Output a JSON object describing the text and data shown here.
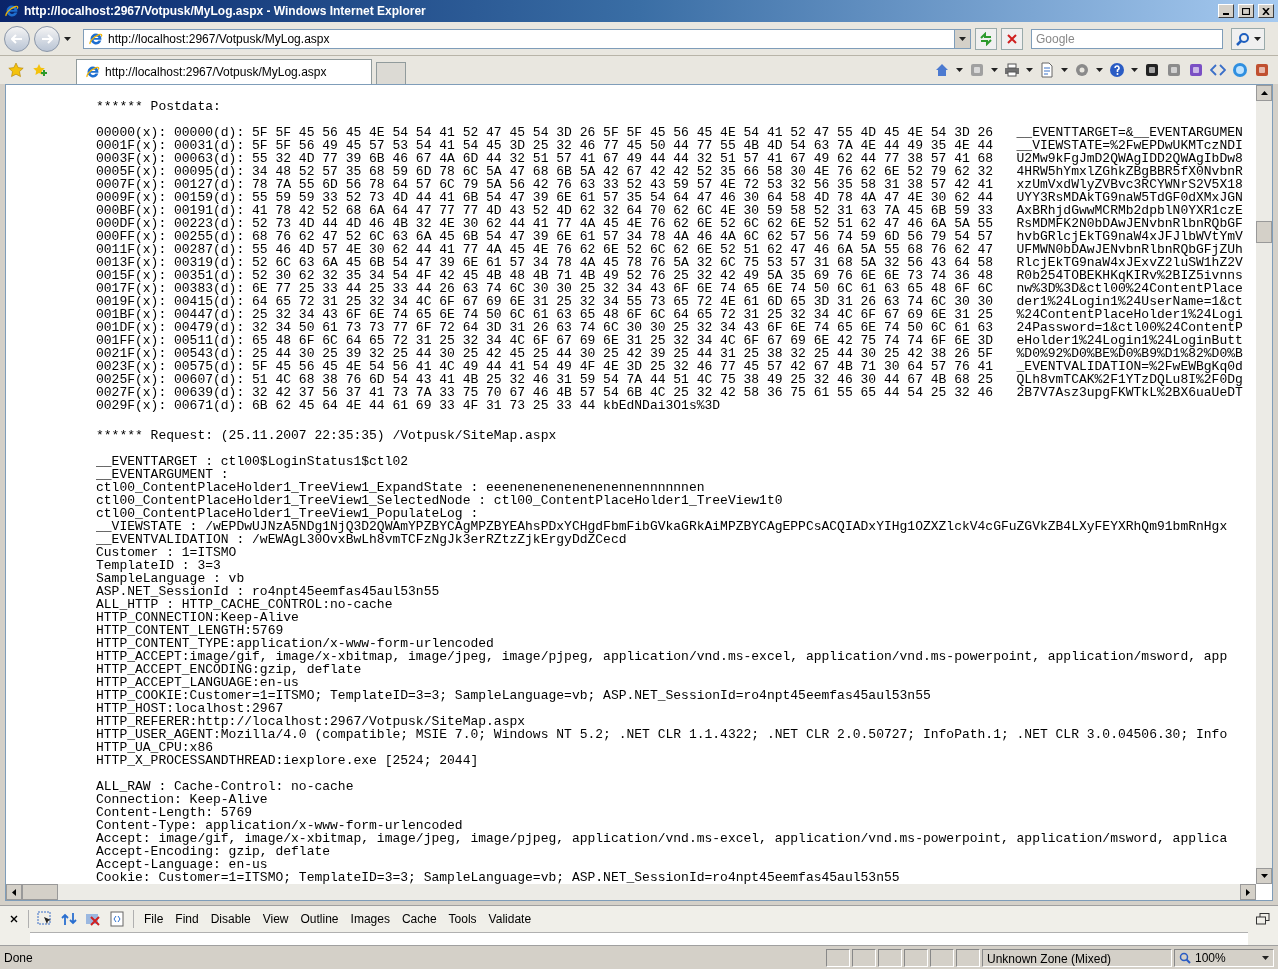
{
  "window": {
    "title": "http://localhost:2967/Votpusk/MyLog.aspx - Windows Internet Explorer"
  },
  "address_bar": {
    "value": "http://localhost:2967/Votpusk/MyLog.aspx"
  },
  "search": {
    "placeholder": "Google"
  },
  "tabs": [
    {
      "label": "http://localhost:2967/Votpusk/MyLog.aspx",
      "selected": true
    }
  ],
  "postdata": {
    "heading": "****** Postdata:",
    "rows": [
      "00000(x): 00000(d): 5F 5F 45 56 45 4E 54 54 41 52 47 45 54 3D 26 5F 5F 45 56 45 4E 54 41 52 47 55 4D 45 4E 54 3D 26   __EVENTTARGET=&__EVENTARGUMEN",
      "0001F(x): 00031(d): 5F 5F 56 49 45 57 53 54 41 54 45 3D 25 32 46 77 45 50 44 77 55 4B 4D 54 63 7A 4E 44 49 35 4E 44   __VIEWSTATE=%2FwEPDwUKMTczNDI",
      "0003F(x): 00063(d): 55 32 4D 77 39 6B 46 67 4A 6D 44 32 51 57 41 67 49 44 44 32 51 57 41 67 49 62 44 77 38 57 41 68   U2Mw9kFgJmD2QWAgIDD2QWAgIbDw8",
      "0005F(x): 00095(d): 34 48 52 57 35 68 59 6D 78 6C 5A 47 68 6B 5A 42 67 42 42 52 35 66 58 30 4E 76 62 6E 52 79 62 32   4HRW5hYmxlZGhkZBgBBR5fX0NvbnR",
      "0007F(x): 00127(d): 78 7A 55 6D 56 78 64 57 6C 79 5A 56 42 76 63 33 52 43 59 57 4E 72 53 32 56 35 58 31 38 57 42 41   xzUmVxdWlyZVBvc3RCYWNrS2V5X18",
      "0009F(x): 00159(d): 55 59 59 33 52 73 4D 44 41 6B 54 47 39 6E 61 57 35 54 64 47 46 30 64 58 4D 78 4A 47 4E 30 62 44   UYY3RsMDAkTG9naW5TdGF0dXMxJGN",
      "000BF(x): 00191(d): 41 78 42 52 68 6A 64 47 77 77 4D 43 52 4D 62 32 64 70 62 6C 4E 30 59 58 52 31 63 7A 45 6B 59 33   AxBRhjdGwwMCRMb2dpblN0YXR1czE",
      "000DF(x): 00223(d): 52 73 4D 44 4D 46 4B 32 4E 30 62 44 41 77 4A 45 4E 76 62 6E 52 6C 62 6E 52 51 62 47 46 6A 5A 55   RsMDMFK2N0bDAwJENvbnRlbnRQbGF",
      "000FF(x): 00255(d): 68 76 62 47 52 6C 63 6A 45 6B 54 47 39 6E 61 57 34 78 4A 46 4A 6C 62 57 56 74 59 6D 56 79 54 57   hvbGRlcjEkTG9naW4xJFJlbWVtYmV",
      "0011F(x): 00287(d): 55 46 4D 57 4E 30 62 44 41 77 4A 45 4E 76 62 6E 52 6C 62 6E 52 51 62 47 46 6A 5A 55 68 76 62 47   UFMWN0bDAwJENvbnRlbnRQbGFjZUh",
      "0013F(x): 00319(d): 52 6C 63 6A 45 6B 54 47 39 6E 61 57 34 78 4A 45 78 76 5A 32 6C 75 53 57 31 68 5A 32 56 43 64 58   RlcjEkTG9naW4xJExvZ2luSW1hZ2V",
      "0015F(x): 00351(d): 52 30 62 32 35 34 54 4F 42 45 4B 48 4B 71 4B 49 52 76 25 32 42 49 5A 35 69 76 6E 6E 73 74 36 48   R0b254TOBEKHKqKIRv%2BIZ5ivnns",
      "0017F(x): 00383(d): 6E 77 25 33 44 25 33 44 26 63 74 6C 30 30 25 32 34 43 6F 6E 74 65 6E 74 50 6C 61 63 65 48 6F 6C   nw%3D%3D&ctl00%24ContentPlace",
      "0019F(x): 00415(d): 64 65 72 31 25 32 34 4C 6F 67 69 6E 31 25 32 34 55 73 65 72 4E 61 6D 65 3D 31 26 63 74 6C 30 30   der1%24Login1%24UserName=1&ct",
      "001BF(x): 00447(d): 25 32 34 43 6F 6E 74 65 6E 74 50 6C 61 63 65 48 6F 6C 64 65 72 31 25 32 34 4C 6F 67 69 6E 31 25   %24ContentPlaceHolder1%24Logi",
      "001DF(x): 00479(d): 32 34 50 61 73 73 77 6F 72 64 3D 31 26 63 74 6C 30 30 25 32 34 43 6F 6E 74 65 6E 74 50 6C 61 63   24Password=1&ctl00%24ContentP",
      "001FF(x): 00511(d): 65 48 6F 6C 64 65 72 31 25 32 34 4C 6F 67 69 6E 31 25 32 34 4C 6F 67 69 6E 42 75 74 74 6F 6E 3D   eHolder1%24Login1%24LoginButt",
      "0021F(x): 00543(d): 25 44 30 25 39 32 25 44 30 25 42 45 25 44 30 25 42 39 25 44 31 25 38 32 25 44 30 25 42 38 26 5F   %D0%92%D0%BE%D0%B9%D1%82%D0%B",
      "0023F(x): 00575(d): 5F 45 56 45 4E 54 56 41 4C 49 44 41 54 49 4F 4E 3D 25 32 46 77 45 57 42 67 4B 71 30 64 57 76 41   _EVENTVALIDATION=%2FwEWBgKq0d",
      "0025F(x): 00607(d): 51 4C 68 38 76 6D 54 43 41 4B 25 32 46 31 59 54 7A 44 51 4C 75 38 49 25 32 46 30 44 67 4B 68 25   QLh8vmTCAK%2F1YTzDQLu8I%2F0Dg",
      "0027F(x): 00639(d): 32 42 37 56 37 41 73 7A 33 75 70 67 46 4B 57 54 6B 4C 25 32 42 58 36 75 61 55 65 44 54 25 32 46   2B7V7Asz3upgFKWTkL%2BX6uaUeDT",
      "0029F(x): 00671(d): 6B 62 45 64 4E 44 61 69 33 4F 31 73 25 33 44 kbEdNDai3O1s%3D"
    ]
  },
  "request": {
    "heading": "****** Request: (25.11.2007 22:35:35) /Votpusk/SiteMap.aspx",
    "fields": [
      "__EVENTTARGET : ctl00$LoginStatus1$ctl02",
      "__EVENTARGUMENT :",
      "ctl00_ContentPlaceHolder1_TreeView1_ExpandState : eeenenenenenenenennennnnnnen",
      "ctl00_ContentPlaceHolder1_TreeView1_SelectedNode : ctl00_ContentPlaceHolder1_TreeView1t0",
      "ctl00_ContentPlaceHolder1_TreeView1_PopulateLog :",
      "__VIEWSTATE : /wEPDwUJNzA5NDg1NjQ3D2QWAmYPZBYCAgMPZBYEAhsPDxYCHgdFbmFibGVkaGRkAiMPZBYCAgEPPCsACQIADxYIHg1OZXZlckV4cGFuZGVkZB4LXyFEYXRhQm91bmRnHgx",
      "__EVENTVALIDATION : /wEWAgL30OvxBwLh8vmTCFzNgJk3erRZtzZjkErgyDdZCecd",
      "Customer : 1=ITSMO",
      "TemplateID : 3=3",
      "SampleLanguage : vb",
      "ASP.NET_SessionId : ro4npt45eemfas45aul53n55",
      "ALL_HTTP : HTTP_CACHE_CONTROL:no-cache",
      "HTTP_CONNECTION:Keep-Alive",
      "HTTP_CONTENT_LENGTH:5769",
      "HTTP_CONTENT_TYPE:application/x-www-form-urlencoded",
      "HTTP_ACCEPT:image/gif, image/x-xbitmap, image/jpeg, image/pjpeg, application/vnd.ms-excel, application/vnd.ms-powerpoint, application/msword, app",
      "HTTP_ACCEPT_ENCODING:gzip, deflate",
      "HTTP_ACCEPT_LANGUAGE:en-us",
      "HTTP_COOKIE:Customer=1=ITSMO; TemplateID=3=3; SampleLanguage=vb; ASP.NET_SessionId=ro4npt45eemfas45aul53n55",
      "HTTP_HOST:localhost:2967",
      "HTTP_REFERER:http://localhost:2967/Votpusk/SiteMap.aspx",
      "HTTP_USER_AGENT:Mozilla/4.0 (compatible; MSIE 7.0; Windows NT 5.2; .NET CLR 1.1.4322; .NET CLR 2.0.50727; InfoPath.1; .NET CLR 3.0.04506.30; Info",
      "HTTP_UA_CPU:x86",
      "HTTP_X_PROCESSANDTHREAD:iexplore.exe [2524; 2044]"
    ],
    "raw": [
      "ALL_RAW : Cache-Control: no-cache",
      "Connection: Keep-Alive",
      "Content-Length: 5769",
      "Content-Type: application/x-www-form-urlencoded",
      "Accept: image/gif, image/x-xbitmap, image/jpeg, image/pjpeg, application/vnd.ms-excel, application/vnd.ms-powerpoint, application/msword, applica",
      "Accept-Encoding: gzip, deflate",
      "Accept-Language: en-us",
      "Cookie: Customer=1=ITSMO; TemplateID=3=3; SampleLanguage=vb; ASP.NET_SessionId=ro4npt45eemfas45aul53n55"
    ]
  },
  "dev_toolbar": {
    "menu": [
      "File",
      "Find",
      "Disable",
      "View",
      "Outline",
      "Images",
      "Cache",
      "Tools",
      "Validate"
    ]
  },
  "status_bar": {
    "status": "Done",
    "zone": "Unknown Zone (Mixed)",
    "zoom": "100%"
  }
}
